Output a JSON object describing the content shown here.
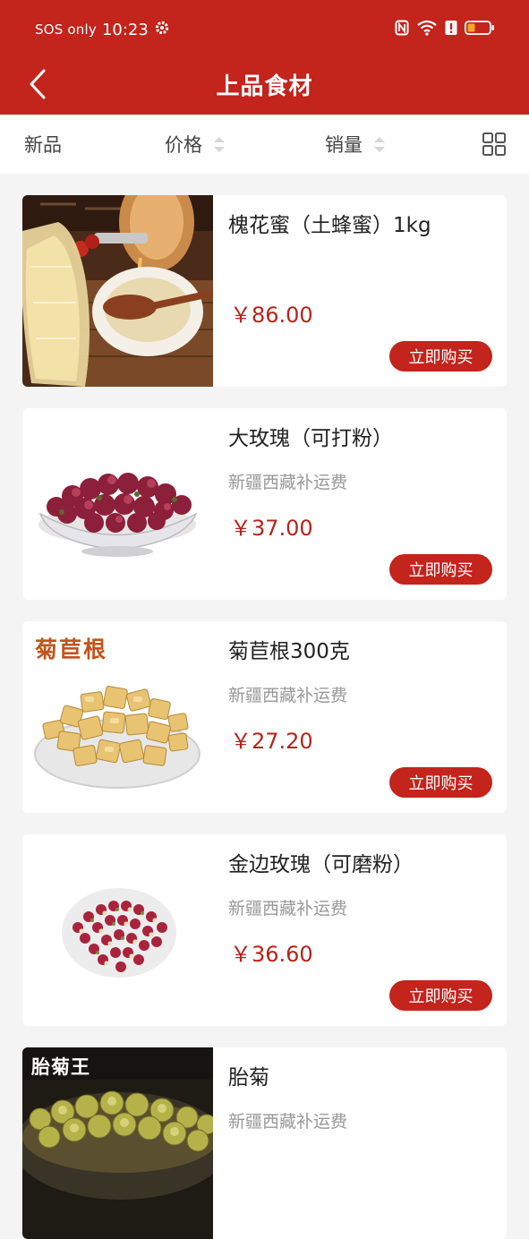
{
  "status_bar": {
    "carrier": "SOS only",
    "time": "10:23"
  },
  "header": {
    "title": "上品食材"
  },
  "sort_bar": {
    "new_label": "新品",
    "price_label": "价格",
    "sales_label": "销量"
  },
  "colors": {
    "brand_red": "#c3241c",
    "price_red": "#b8231b"
  },
  "products": [
    {
      "name": "槐花蜜（土蜂蜜）1kg",
      "note": "",
      "price": "￥86.00",
      "buy_label": "立即购买",
      "image_text": ""
    },
    {
      "name": "大玫瑰（可打粉）",
      "note": "新疆西藏补运费",
      "price": "￥37.00",
      "buy_label": "立即购买",
      "image_text": ""
    },
    {
      "name": "菊苣根300克",
      "note": "新疆西藏补运费",
      "price": "￥27.20",
      "buy_label": "立即购买",
      "image_text": "菊苣根"
    },
    {
      "name": "金边玫瑰（可磨粉）",
      "note": "新疆西藏补运费",
      "price": "￥36.60",
      "buy_label": "立即购买",
      "image_text": ""
    },
    {
      "name": "胎菊",
      "note": "新疆西藏补运费",
      "price": "",
      "buy_label": "",
      "image_text": "胎菊王"
    }
  ]
}
